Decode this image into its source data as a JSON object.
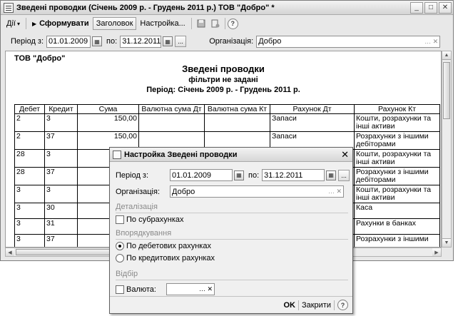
{
  "window": {
    "title": "Зведені проводки (Січень 2009 р. - Грудень 2011 р.) ТОВ \"Добро\" *",
    "min_glyph": "_",
    "max_glyph": "□",
    "close_glyph": "✕"
  },
  "toolbar": {
    "actions_label": "Дії",
    "actions_arrow": "▾",
    "generate_arrow": "▶",
    "generate_label": "Сформувати",
    "header_label": "Заголовок",
    "settings_label": "Настройка...",
    "help_glyph": "?"
  },
  "filter": {
    "period_from_label": "Період з:",
    "date_from": "01.01.2009",
    "to_label": "по:",
    "date_to": "31.12.2011",
    "org_label": "Організація:",
    "org_value": "Добро",
    "dots": "..."
  },
  "report": {
    "company": "ТОВ \"Добро\"",
    "title": "Зведені проводки",
    "subtitle": "фільтри не задані",
    "period": "Період: Січень 2009 р. - Грудень 2011 р.",
    "columns": [
      "Дебет",
      "Кредит",
      "Сума",
      "Валютна сума Дт",
      "Валютна сума Кт",
      "Рахунок Дт",
      "Рахунок Кт"
    ],
    "rows": [
      [
        "2",
        "3",
        "150,00",
        "",
        "",
        "Запаси",
        "Кошти, розрахунки та інші активи"
      ],
      [
        "2",
        "37",
        "150,00",
        "",
        "",
        "Запаси",
        "Розрахунки з іншими дебіторами"
      ],
      [
        "28",
        "3",
        "",
        "",
        "",
        "",
        "Кошти, розрахунки та інші активи"
      ],
      [
        "28",
        "37",
        "",
        "",
        "",
        "",
        "Розрахунки з іншими дебіторами"
      ],
      [
        "3",
        "3",
        "",
        "",
        "",
        "",
        "Кошти, розрахунки та інші активи"
      ],
      [
        "3",
        "30",
        "",
        "",
        "",
        "",
        "Каса"
      ],
      [
        "3",
        "31",
        "",
        "",
        "",
        "",
        "Рахунки в банках"
      ],
      [
        "3",
        "37",
        "",
        "",
        "",
        "",
        "Розрахунки з іншими"
      ]
    ]
  },
  "dialog": {
    "title": "Настройка Зведені проводки",
    "close_glyph": "✕",
    "period_label": "Період з:",
    "date_from": "01.01.2009",
    "to_label": "по:",
    "date_to": "31.12.2011",
    "org_label": "Організація:",
    "org_value": "Добро",
    "detail_section": "Деталізація",
    "by_subaccounts": "По субрахунках",
    "order_section": "Впорядкування",
    "by_debit": "По дебетових рахунках",
    "by_credit": "По кредитових рахунках",
    "selection_section": "Відбір",
    "currency_label": "Валюта:",
    "ok": "OK",
    "close": "Закрити",
    "help_glyph": "?"
  }
}
